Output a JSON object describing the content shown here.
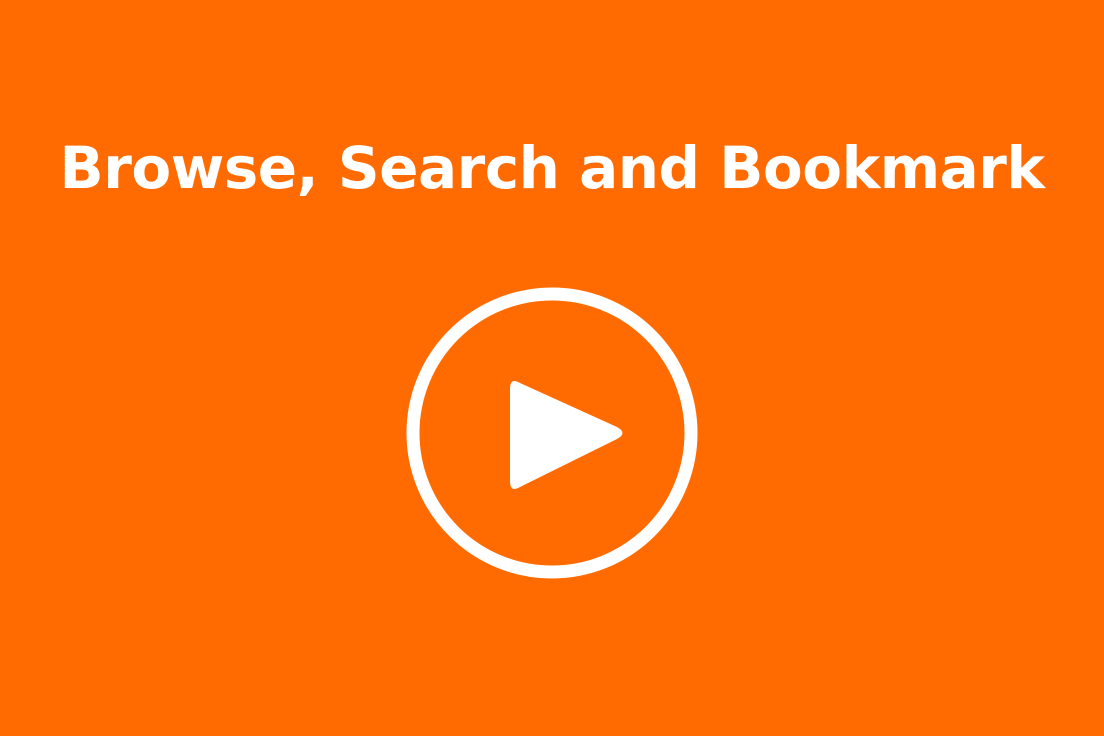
{
  "video": {
    "title": "Browse, Search and Bookmark",
    "play_icon": "play-icon"
  },
  "colors": {
    "background": "#ff6b00",
    "foreground": "#ffffff"
  }
}
